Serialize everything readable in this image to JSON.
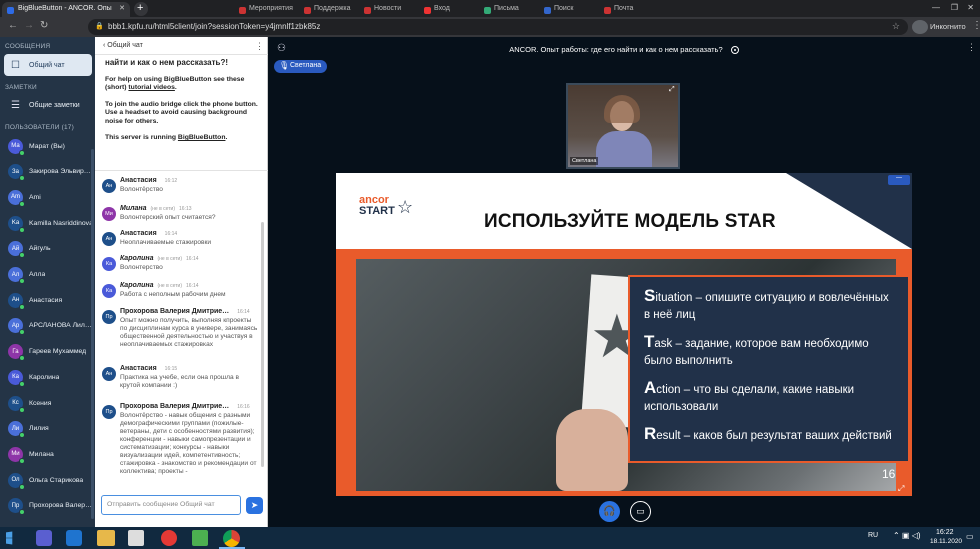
{
  "browser": {
    "tabs": [
      {
        "label": "BigBlueButton - ANCOR. Опы"
      },
      {
        "label": "Мероприятия"
      },
      {
        "label": "Поддержка"
      },
      {
        "label": "Новости"
      },
      {
        "label": "Вход"
      },
      {
        "label": "Письма"
      },
      {
        "label": "Поиск"
      },
      {
        "label": "Почта"
      }
    ],
    "url": "bbb1.kpfu.ru/html5client/join?sessionToken=y4jmnlf1zbk85z",
    "incognito_label": "Инкогнито"
  },
  "sidebar": {
    "messages_title": "СООБЩЕНИЯ",
    "public_chat_label": "Общий чат",
    "notes_title": "ЗАМЕТКИ",
    "shared_notes_label": "Общие заметки",
    "users_title": "ПОЛЬЗОВАТЕЛИ (17)",
    "users": [
      {
        "initials": "Ма",
        "name": "Марат (Вы)",
        "color": "#4a5ad9"
      },
      {
        "initials": "За",
        "name": "Закирова Эльвир…",
        "color": "#1e4f8a"
      },
      {
        "initials": "Am",
        "name": "Ami",
        "color": "#4a6fd9"
      },
      {
        "initials": "Ka",
        "name": "Kamilla Nasriddinova",
        "color": "#1e4f8a"
      },
      {
        "initials": "Ай",
        "name": "Айгуль",
        "color": "#4a6fd9"
      },
      {
        "initials": "Ал",
        "name": "Алла",
        "color": "#4a6fd9"
      },
      {
        "initials": "Ан",
        "name": "Анастасия",
        "color": "#1e4f8a"
      },
      {
        "initials": "Ар",
        "name": "АРСЛАНОВА Лил…",
        "color": "#4a6fd9"
      },
      {
        "initials": "Га",
        "name": "Гареев Мухаммед",
        "color": "#8e35a8"
      },
      {
        "initials": "Ка",
        "name": "Каролина",
        "color": "#4a5ad9"
      },
      {
        "initials": "Кс",
        "name": "Ксения",
        "color": "#1e4f8a"
      },
      {
        "initials": "Ли",
        "name": "Лилия",
        "color": "#4a6fd9"
      },
      {
        "initials": "Ми",
        "name": "Милана",
        "color": "#8e35a8"
      },
      {
        "initials": "Ол",
        "name": "Ольга Старикова",
        "color": "#1e4f8a"
      },
      {
        "initials": "Пр",
        "name": "Прохорова Валер…",
        "color": "#1e4f8a"
      }
    ]
  },
  "chat": {
    "title": "Общий чат",
    "welcome_heading": "найти и как о нем рассказать?!",
    "help_prefix": "For help on using BigBlueButton see these (short) ",
    "help_link": "tutorial videos",
    "help_suffix": ".",
    "audio_text": "To join the audio bridge click the phone button. Use a headset to avoid causing background noise for others.",
    "server_prefix": "This server is running ",
    "server_link": "BigBlueButton",
    "server_suffix": ".",
    "messages": [
      {
        "initials": "Ан",
        "name": "Анастасия",
        "status": "",
        "time": "16:12",
        "text": "Волонтёрство",
        "color": "#1e4f8a"
      },
      {
        "initials": "Ми",
        "name": "Милана",
        "status": "(не в сети)",
        "time": "16:13",
        "text": "Волонтерский опыт считается?",
        "color": "#8e35a8"
      },
      {
        "initials": "Ан",
        "name": "Анастасия",
        "status": "",
        "time": "16:14",
        "text": "Неоплачиваемые стажировки",
        "color": "#1e4f8a"
      },
      {
        "initials": "Ка",
        "name": "Каролина",
        "status": "(не в сети)",
        "time": "16:14",
        "text": "Волонтерство",
        "color": "#4a5ad9"
      },
      {
        "initials": "Ка",
        "name": "Каролина",
        "status": "(не в сети)",
        "time": "16:14",
        "text": "Работа с неполным рабочим днем",
        "color": "#4a5ad9"
      },
      {
        "initials": "Пр",
        "name": "Прохорова Валерия Дмитрие…",
        "status": "",
        "time": "16:14",
        "text": "Опыт можно получить, выполняя кпроекты по дисциплинам курса в универе, занимаясь общественной деятельностью и участвуя в неоплачиваемых стажировках",
        "color": "#1e4f8a"
      },
      {
        "initials": "Ан",
        "name": "Анастасия",
        "status": "",
        "time": "16:15",
        "text": "Практика на учебе, если она прошла в крутой компании :)",
        "color": "#1e4f8a"
      },
      {
        "initials": "Пр",
        "name": "Прохорова Валерия Дмитрие…",
        "status": "",
        "time": "16:16",
        "text": "Волонтёрство - навык общения с разными демографическими группами (пожилые-ветераны, дети с особенностями развития); конференции - навыки самопрезентации и систематизации; конкурсы - навыки визуализации идей, компетентивность; стажировка - знакомство и рекомендации от коллектива; проекты -",
        "color": "#1e4f8a"
      }
    ],
    "input_placeholder": "Отправить сообщение Общий чат"
  },
  "main": {
    "meeting_title": "ANCOR. Опыт работы: где его найти и как о нем рассказать?",
    "talking_user": "Светлана",
    "webcam_user": "Светлана",
    "slide": {
      "logo_top": "ancor",
      "logo_bottom": "START",
      "heading": "ИСПОЛЬЗУЙТЕ МОДЕЛЬ STAR",
      "items": [
        {
          "letter": "S",
          "rest": "ituation – опишите ситуацию и вовлечённых в неё лиц"
        },
        {
          "letter": "T",
          "rest": "ask – задание, которое вам необходимо было выполнить"
        },
        {
          "letter": "A",
          "rest": "ction – что вы сделали, какие навыки использовали"
        },
        {
          "letter": "R",
          "rest": "esult – каков был результат ваших действий"
        }
      ],
      "page_number": "16"
    }
  },
  "taskbar": {
    "lang": "RU",
    "time": "16:22",
    "date": "18.11.2020"
  }
}
